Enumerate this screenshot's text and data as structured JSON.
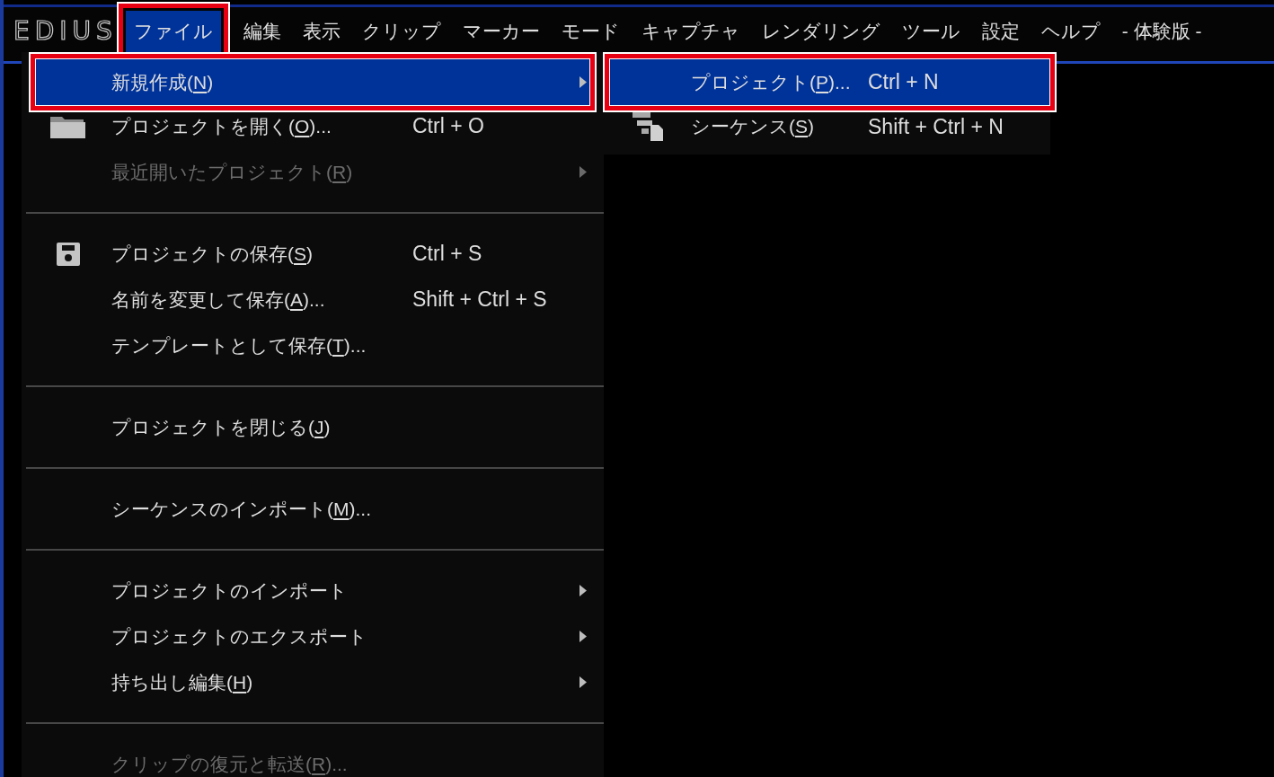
{
  "menu_bar": {
    "logo": "EDIUS",
    "items": [
      {
        "label": "ファイル",
        "selected": true,
        "annotated": true
      },
      {
        "label": "編集",
        "selected": false,
        "annotated": false
      },
      {
        "label": "表示",
        "selected": false,
        "annotated": false
      },
      {
        "label": "クリップ",
        "selected": false,
        "annotated": false
      },
      {
        "label": "マーカー",
        "selected": false,
        "annotated": false
      },
      {
        "label": "モード",
        "selected": false,
        "annotated": false
      },
      {
        "label": "キャプチャ",
        "selected": false,
        "annotated": false
      },
      {
        "label": "レンダリング",
        "selected": false,
        "annotated": false
      },
      {
        "label": "ツール",
        "selected": false,
        "annotated": false
      },
      {
        "label": "設定",
        "selected": false,
        "annotated": false
      },
      {
        "label": "ヘルプ",
        "selected": false,
        "annotated": false
      }
    ],
    "edition_label": "- 体験版 -"
  },
  "file_menu": {
    "items": [
      {
        "kind": "item",
        "label": "新規作成(N)",
        "selected": true,
        "disabled": false,
        "submenu": true,
        "annotated": true
      },
      {
        "kind": "folder-item",
        "label": "プロジェクトを開く(O)...",
        "shortcut": "Ctrl + O",
        "selected": false,
        "disabled": false,
        "submenu": false,
        "annotated": false
      },
      {
        "kind": "item",
        "label": "最近開いたプロジェクト(R)",
        "selected": false,
        "disabled": true,
        "submenu": true,
        "annotated": false
      },
      {
        "kind": "separator"
      },
      {
        "kind": "disk-item",
        "label": "プロジェクトの保存(S)",
        "shortcut": "Ctrl + S",
        "selected": false,
        "disabled": false,
        "submenu": false,
        "annotated": false
      },
      {
        "kind": "item",
        "label": "名前を変更して保存(A)...",
        "shortcut": "Shift + Ctrl + S",
        "selected": false,
        "disabled": false,
        "submenu": false,
        "annotated": false
      },
      {
        "kind": "item",
        "label": "テンプレートとして保存(T)...",
        "selected": false,
        "disabled": false,
        "submenu": false,
        "annotated": false
      },
      {
        "kind": "separator"
      },
      {
        "kind": "item",
        "label": "プロジェクトを閉じる(J)",
        "selected": false,
        "disabled": false,
        "submenu": false,
        "annotated": false
      },
      {
        "kind": "separator"
      },
      {
        "kind": "item",
        "label": "シーケンスのインポート(M)...",
        "selected": false,
        "disabled": false,
        "submenu": false,
        "annotated": false
      },
      {
        "kind": "separator"
      },
      {
        "kind": "item",
        "label": "プロジェクトのインポート",
        "selected": false,
        "disabled": false,
        "submenu": true,
        "annotated": false
      },
      {
        "kind": "item",
        "label": "プロジェクトのエクスポート",
        "selected": false,
        "disabled": false,
        "submenu": true,
        "annotated": false
      },
      {
        "kind": "item",
        "label": "持ち出し編集(H)",
        "selected": false,
        "disabled": false,
        "submenu": true,
        "annotated": false
      },
      {
        "kind": "separator"
      },
      {
        "kind": "item",
        "label": "クリップの復元と転送(R)...",
        "selected": false,
        "disabled": true,
        "submenu": false,
        "annotated": false
      }
    ]
  },
  "new_submenu": {
    "items": [
      {
        "kind": "item",
        "label": "プロジェクト(P)...",
        "shortcut": "Ctrl + N",
        "selected": true,
        "annotated": true
      },
      {
        "kind": "sequence-item",
        "label": "シーケンス(S)",
        "shortcut": "Shift + Ctrl + N",
        "selected": false,
        "annotated": false
      }
    ]
  }
}
